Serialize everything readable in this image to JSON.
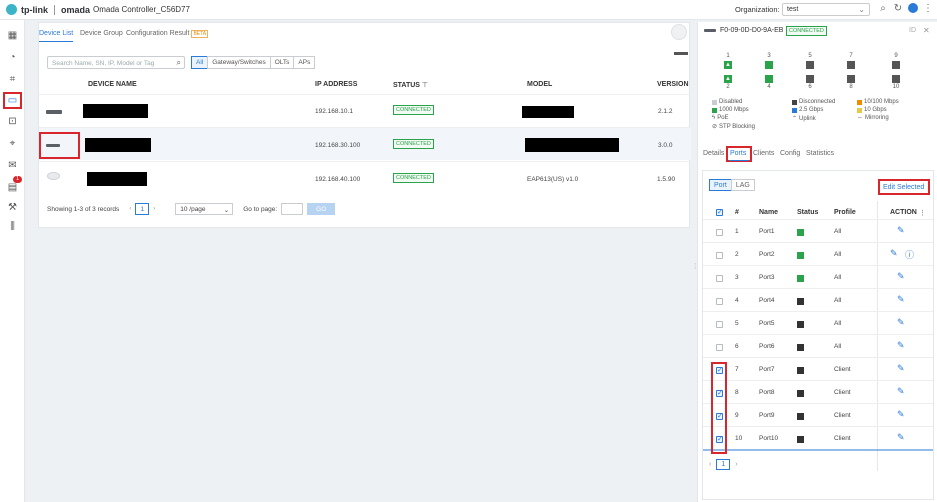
{
  "topbar": {
    "logo_brand": "tp-link",
    "logo_product": "omada",
    "controller_name": "Omada Controller_C56D77",
    "org_label": "Organization:",
    "org_value": "test"
  },
  "sidebar": {
    "alert_count": "1"
  },
  "device_list": {
    "tabs": [
      "Device List",
      "Device Group",
      "Configuration Result"
    ],
    "beta_badge": "BETA",
    "search_placeholder": "Search Name, SN, IP, Model or Tag",
    "filters": [
      "All",
      "Gateway/Switches",
      "OLTs",
      "APs"
    ],
    "columns": {
      "name": "DEVICE NAME",
      "ip": "IP ADDRESS",
      "status": "STATUS",
      "model": "MODEL",
      "version": "VERSION"
    },
    "rows": [
      {
        "ip": "192.168.10.1",
        "status": "CONNECTED",
        "model": "",
        "version": "2.1.2"
      },
      {
        "ip": "192.168.30.100",
        "status": "CONNECTED",
        "model": "",
        "version": "3.0.0"
      },
      {
        "ip": "192.168.40.100",
        "status": "CONNECTED",
        "model": "EAP613(US) v1.0",
        "version": "1.5.90"
      }
    ],
    "pager": {
      "summary": "Showing 1-3 of 3 records",
      "page": "1",
      "per_page": "10 /page",
      "goto_label": "Go to page:",
      "go_button": "GO"
    }
  },
  "detail_panel": {
    "mac": "F0-09-0D-D0-9A-EB",
    "status": "CONNECTED",
    "port_numbers_top": [
      "1",
      "3",
      "5",
      "7",
      "9"
    ],
    "port_numbers_bottom": [
      "2",
      "4",
      "6",
      "8",
      "10"
    ],
    "legend": {
      "disabled": "Disabled",
      "disconnected": "Disconnected",
      "speed_10_100": "10/100 Mbps",
      "speed_1000": "1000 Mbps",
      "speed_2_5g": "2.5 Gbps",
      "speed_10g": "10 Gbps",
      "poe": "PoE",
      "uplink": "Uplink",
      "mirroring": "Mirroring",
      "stp": "STP Blocking"
    },
    "tabs": [
      "Details",
      "Ports",
      "Clients",
      "Config",
      "Statistics"
    ],
    "subtabs": [
      "Port",
      "LAG"
    ],
    "edit_selected": "Edit Selected",
    "columns": {
      "num": "#",
      "name": "Name",
      "status": "Status",
      "profile": "Profile",
      "action": "ACTION"
    },
    "ports": [
      {
        "num": "1",
        "name": "Port1",
        "profile": "All"
      },
      {
        "num": "2",
        "name": "Port2",
        "profile": "All"
      },
      {
        "num": "3",
        "name": "Port3",
        "profile": "All"
      },
      {
        "num": "4",
        "name": "Port4",
        "profile": "All"
      },
      {
        "num": "5",
        "name": "Port5",
        "profile": "All"
      },
      {
        "num": "6",
        "name": "Port6",
        "profile": "All"
      },
      {
        "num": "7",
        "name": "Port7",
        "profile": "Client"
      },
      {
        "num": "8",
        "name": "Port8",
        "profile": "Client"
      },
      {
        "num": "9",
        "name": "Port9",
        "profile": "Client"
      },
      {
        "num": "10",
        "name": "Port10",
        "profile": "Client"
      }
    ],
    "page": "1"
  }
}
